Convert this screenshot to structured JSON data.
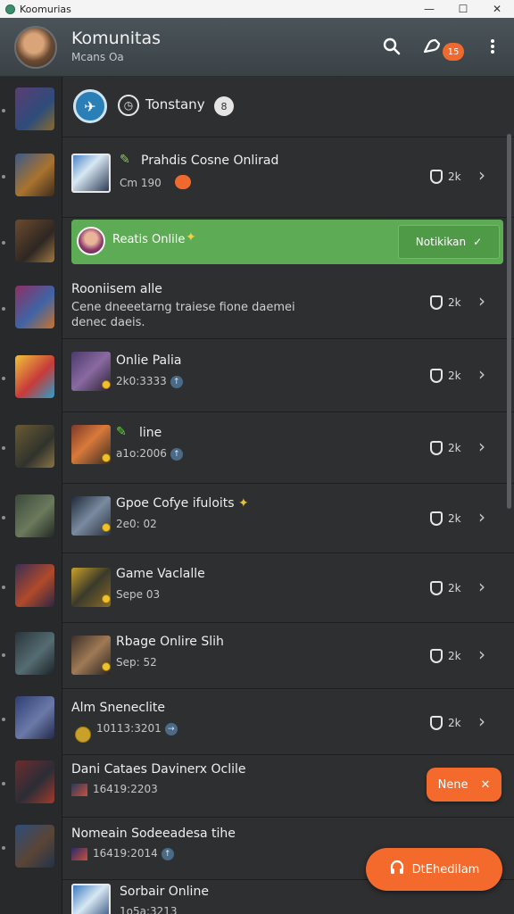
{
  "window": {
    "title": "Koomurias",
    "minimize": "—",
    "maximize": "☐",
    "close": "✕"
  },
  "header": {
    "title": "Komunitas",
    "subtitle": "Mcans Oa",
    "badge": "15"
  },
  "top_row": {
    "title": "Tonstany",
    "badge": "8"
  },
  "rows": [
    {
      "name": "Prahdis Cosne Onlirad",
      "meta": "Cm 190",
      "count": "2k"
    },
    {
      "name": "Reatis Onlile",
      "button": "Notikikan"
    },
    {
      "name": "Rooniisem alle",
      "desc": "Cene dneeetarng traiese fione daemei denec daeis.",
      "count": "2k"
    },
    {
      "name": "Onlie Palia",
      "meta": "2k0:3333",
      "count": "2k"
    },
    {
      "name": "line",
      "meta": "a1o:2006",
      "count": "2k"
    },
    {
      "name": "Gpoe Cofye ifuloits",
      "meta": "2e0: 02",
      "count": "2k"
    },
    {
      "name": "Game Vaclalle",
      "meta": "Sepe 03",
      "count": "2k"
    },
    {
      "name": "Rbage Onlire Slih",
      "meta": "Sep: 52",
      "count": "2k"
    },
    {
      "name": "Alm Sneneclite",
      "meta": "10113:3201",
      "count": "2k"
    },
    {
      "name": "Dani Cataes Davinerx Oclile",
      "meta": "16419:2203"
    },
    {
      "name": "Nomeain Sodeeadesa tihe",
      "meta": "16419:2014"
    },
    {
      "name": "Sorbair Online",
      "meta": "1o5a:3213"
    }
  ],
  "fab_small": {
    "label": "Nene",
    "icon": "✕"
  },
  "fab_large": {
    "label": "DtEhedilam"
  },
  "colors": {
    "accent": "#f36a2c",
    "green": "#5dab55"
  },
  "icons": [
    "search-icon",
    "notification-icon",
    "more-icon",
    "chevron-right-icon",
    "shield-icon",
    "clock-icon",
    "check-icon",
    "close-icon"
  ]
}
